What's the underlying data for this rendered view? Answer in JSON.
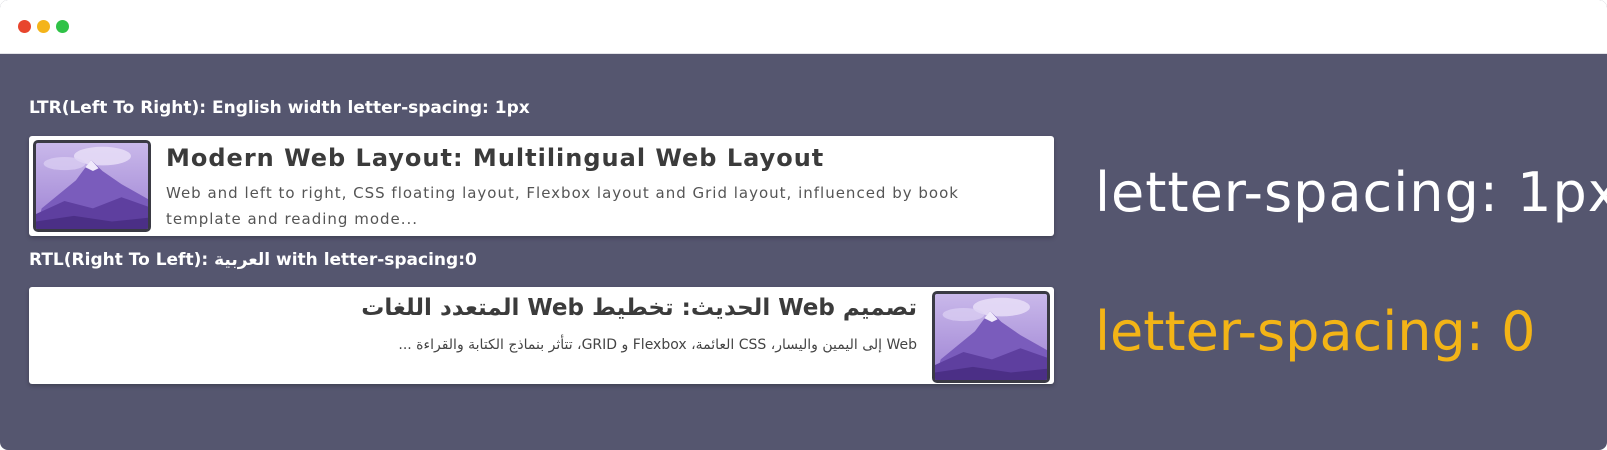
{
  "window": {
    "controls": {
      "close_color": "#e8452d",
      "minimize_color": "#f4b41a",
      "maximize_color": "#2fc247"
    },
    "background_color": "#55566f"
  },
  "ltr": {
    "label": "LTR(Left To Right): English width letter-spacing: 1px",
    "card": {
      "thumbnail_icon": "mountain-image",
      "title": "Modern Web Layout: Multilingual Web Layout",
      "description": "Web and left to right, CSS floating layout, Flexbox layout and Grid layout, influenced by book template and reading mode..."
    },
    "big_label": "letter-spacing: 1px",
    "big_label_color": "#ffffff"
  },
  "rtl": {
    "label": "RTL(Right To Left): العربية with letter-spacing:0",
    "card": {
      "thumbnail_icon": "mountain-image",
      "title": "تصميم Web الحديث: تخطيط Web المتعدد اللغات",
      "description": "Web إلى اليمين واليسار، CSS العائمة، Flexbox و GRID، تتأثر بنماذج الكتابة والقراءة ..."
    },
    "big_label": "letter-spacing: 0",
    "big_label_color": "#f3b416"
  }
}
